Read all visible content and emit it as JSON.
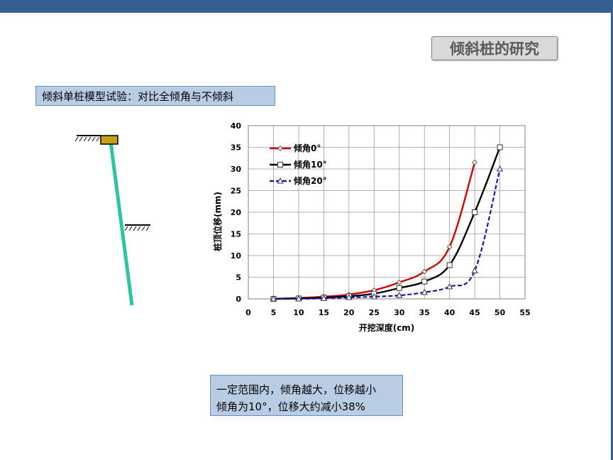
{
  "slide": {
    "title": "倾斜桩的研究",
    "subtitle": "倾斜单桩模型试验：对比全倾角与不倾斜",
    "note_line1": "一定范围内，倾角越大，位移越小",
    "note_line2": "倾角为10°，位移大约减小38%"
  },
  "colors": {
    "header": "#365f91",
    "box_fill": "#b8cce4",
    "pile": "#2ec4a0",
    "pile_cap": "#c8a018"
  },
  "chart_data": {
    "type": "line",
    "xlabel": "开挖深度(cm)",
    "ylabel": "桩顶位移(mm)",
    "xlim": [
      0,
      55
    ],
    "ylim": [
      0,
      40
    ],
    "xticks": [
      0,
      5,
      10,
      15,
      20,
      25,
      30,
      35,
      40,
      45,
      50,
      55
    ],
    "yticks": [
      0,
      5,
      10,
      15,
      20,
      25,
      30,
      35,
      40
    ],
    "grid": true,
    "legend": "top-left",
    "series": [
      {
        "name": "倾角0°",
        "color": "#d40000",
        "marker": "diamond",
        "dashed": false,
        "x": [
          5,
          10,
          15,
          20,
          25,
          30,
          35,
          40,
          45
        ],
        "y": [
          0,
          0.2,
          0.5,
          1,
          2,
          3.8,
          6.3,
          12,
          31.5
        ]
      },
      {
        "name": "倾角10°",
        "color": "#000000",
        "marker": "square",
        "dashed": false,
        "x": [
          5,
          10,
          15,
          20,
          25,
          30,
          35,
          40,
          45,
          50
        ],
        "y": [
          0,
          0.1,
          0.3,
          0.6,
          1.2,
          2.5,
          4,
          7.8,
          20,
          35
        ]
      },
      {
        "name": "倾角20°",
        "color": "#1a1aa8",
        "marker": "triangle",
        "dashed": true,
        "x": [
          5,
          10,
          15,
          20,
          25,
          30,
          35,
          40,
          45,
          50
        ],
        "y": [
          0,
          0,
          0.1,
          0.3,
          0.5,
          0.8,
          1.5,
          2.8,
          6.5,
          30
        ]
      }
    ]
  }
}
